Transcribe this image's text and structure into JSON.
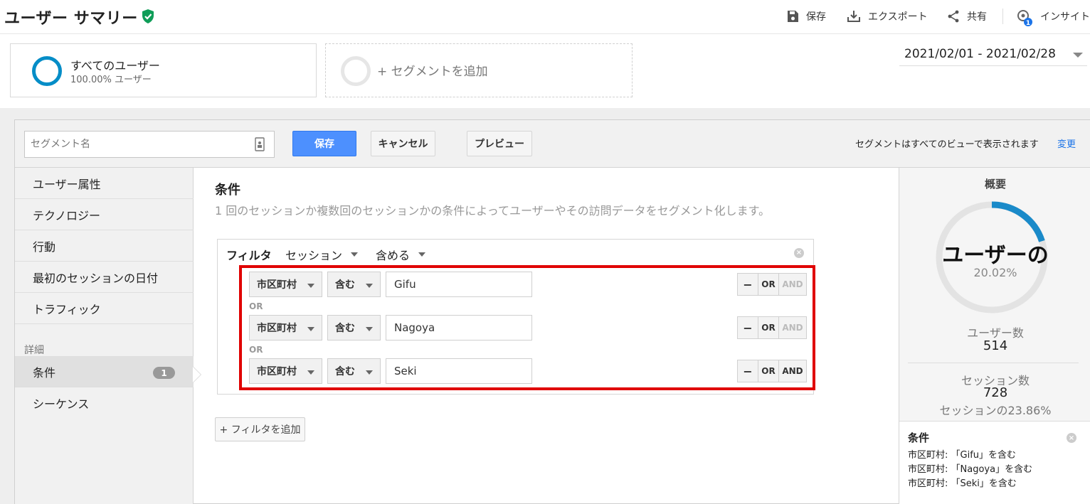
{
  "header": {
    "title": "ユーザー サマリー",
    "tools": {
      "save": "保存",
      "export": "エクスポート",
      "share": "共有",
      "insights": "インサイト",
      "insights_badge": "1"
    }
  },
  "segments": {
    "current": {
      "name": "すべてのユーザー",
      "percent": "100.00% ユーザー",
      "color": "#058dc7"
    },
    "add_label": "+ セグメントを追加"
  },
  "date_range": "2021/02/01 - 2021/02/28",
  "editor": {
    "segment_name_placeholder": "セグメント名",
    "save_button": "保存",
    "cancel_button": "キャンセル",
    "preview_button": "プレビュー",
    "visibility_note": "セグメントはすべてのビューで表示されます",
    "visibility_change": "変更"
  },
  "left_nav": {
    "items": [
      "ユーザー属性",
      "テクノロジー",
      "行動",
      "最初のセッションの日付",
      "トラフィック"
    ],
    "section_label": "詳細",
    "advanced": [
      {
        "label": "条件",
        "badge": "1"
      },
      {
        "label": "シーケンス"
      }
    ]
  },
  "conditions": {
    "title": "条件",
    "description": "1 回のセッションか複数回のセッションかの条件によってユーザーやその訪問データをセグメント化します。",
    "filter": {
      "label": "フィルタ",
      "scope": "セッション",
      "mode": "含める",
      "remove_icon": "×",
      "rows": [
        {
          "dimension": "市区町村",
          "operator": "含む",
          "value": "Gifu",
          "and_enabled": false
        },
        {
          "dimension": "市区町村",
          "operator": "含む",
          "value": "Nagoya",
          "and_enabled": false
        },
        {
          "dimension": "市区町村",
          "operator": "含む",
          "value": "Seki",
          "and_enabled": true
        }
      ],
      "or_separator": "OR",
      "minus": "−",
      "or_label": "OR",
      "and_label": "AND"
    },
    "add_filter": "+ フィルタを追加"
  },
  "summary": {
    "title": "概要",
    "big_label": "ユーザーの",
    "percent": "20.02%",
    "percent_value": 0.2002,
    "users_label": "ユーザー数",
    "users_value": "514",
    "sessions_label": "セッション数",
    "sessions_value": "728",
    "sessions_pct": "セッションの23.86%",
    "conditions_title": "条件",
    "condition_lines": [
      "市区町村: 「Gifu」を含む",
      "市区町村: 「Nagoya」を含む",
      "市区町村: 「Seki」を含む"
    ],
    "remove_icon": "×",
    "accent": "#1a8ac9"
  }
}
